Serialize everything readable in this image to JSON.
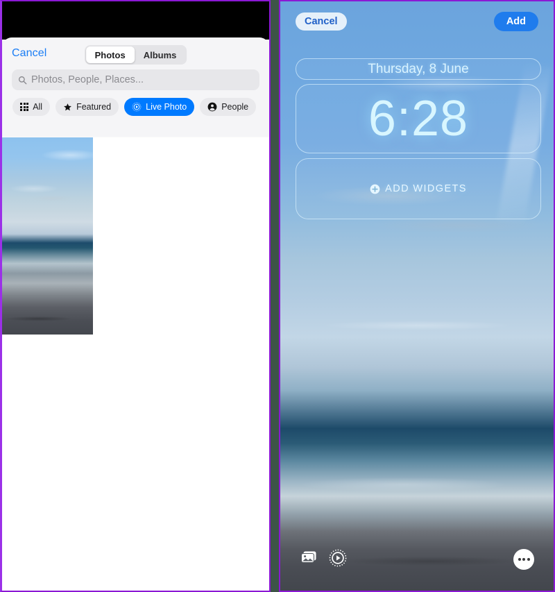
{
  "left_panel": {
    "sheet": {
      "cancel_label": "Cancel",
      "segments": [
        {
          "label": "Photos",
          "active": true
        },
        {
          "label": "Albums",
          "active": false
        }
      ],
      "search": {
        "placeholder": "Photos, People, Places...",
        "value": "",
        "icon": "search-icon"
      },
      "filters": [
        {
          "label": "All",
          "icon": "grid-icon",
          "selected": false
        },
        {
          "label": "Featured",
          "icon": "star-icon",
          "selected": false
        },
        {
          "label": "Live Photo",
          "icon": "live-photo-icon",
          "selected": true
        },
        {
          "label": "People",
          "icon": "person-icon",
          "selected": false
        }
      ]
    },
    "thumbnail": {
      "alt": "beach-ocean-sunset-photo"
    }
  },
  "right_panel": {
    "header": {
      "cancel_label": "Cancel",
      "add_label": "Add"
    },
    "annotation": {
      "type": "arrow",
      "color": "#8b52e8",
      "points_to": "add-button"
    },
    "lock_screen": {
      "date": "Thursday, 8 June",
      "time": "6:28",
      "add_widgets_label": "ADD WIDGETS",
      "add_widgets_icon": "plus-circle-icon",
      "bottom_icons": [
        {
          "name": "photo-shuffle-icon"
        },
        {
          "name": "live-photo-play-icon"
        },
        {
          "name": "more-options-icon"
        }
      ]
    }
  },
  "colors": {
    "accent_blue": "#007aff",
    "add_button_blue": "#1f7ced",
    "annotation_purple": "#8b52e8",
    "panel_border_purple": "#8b18d4",
    "clock_text": "#d8f6ff"
  }
}
